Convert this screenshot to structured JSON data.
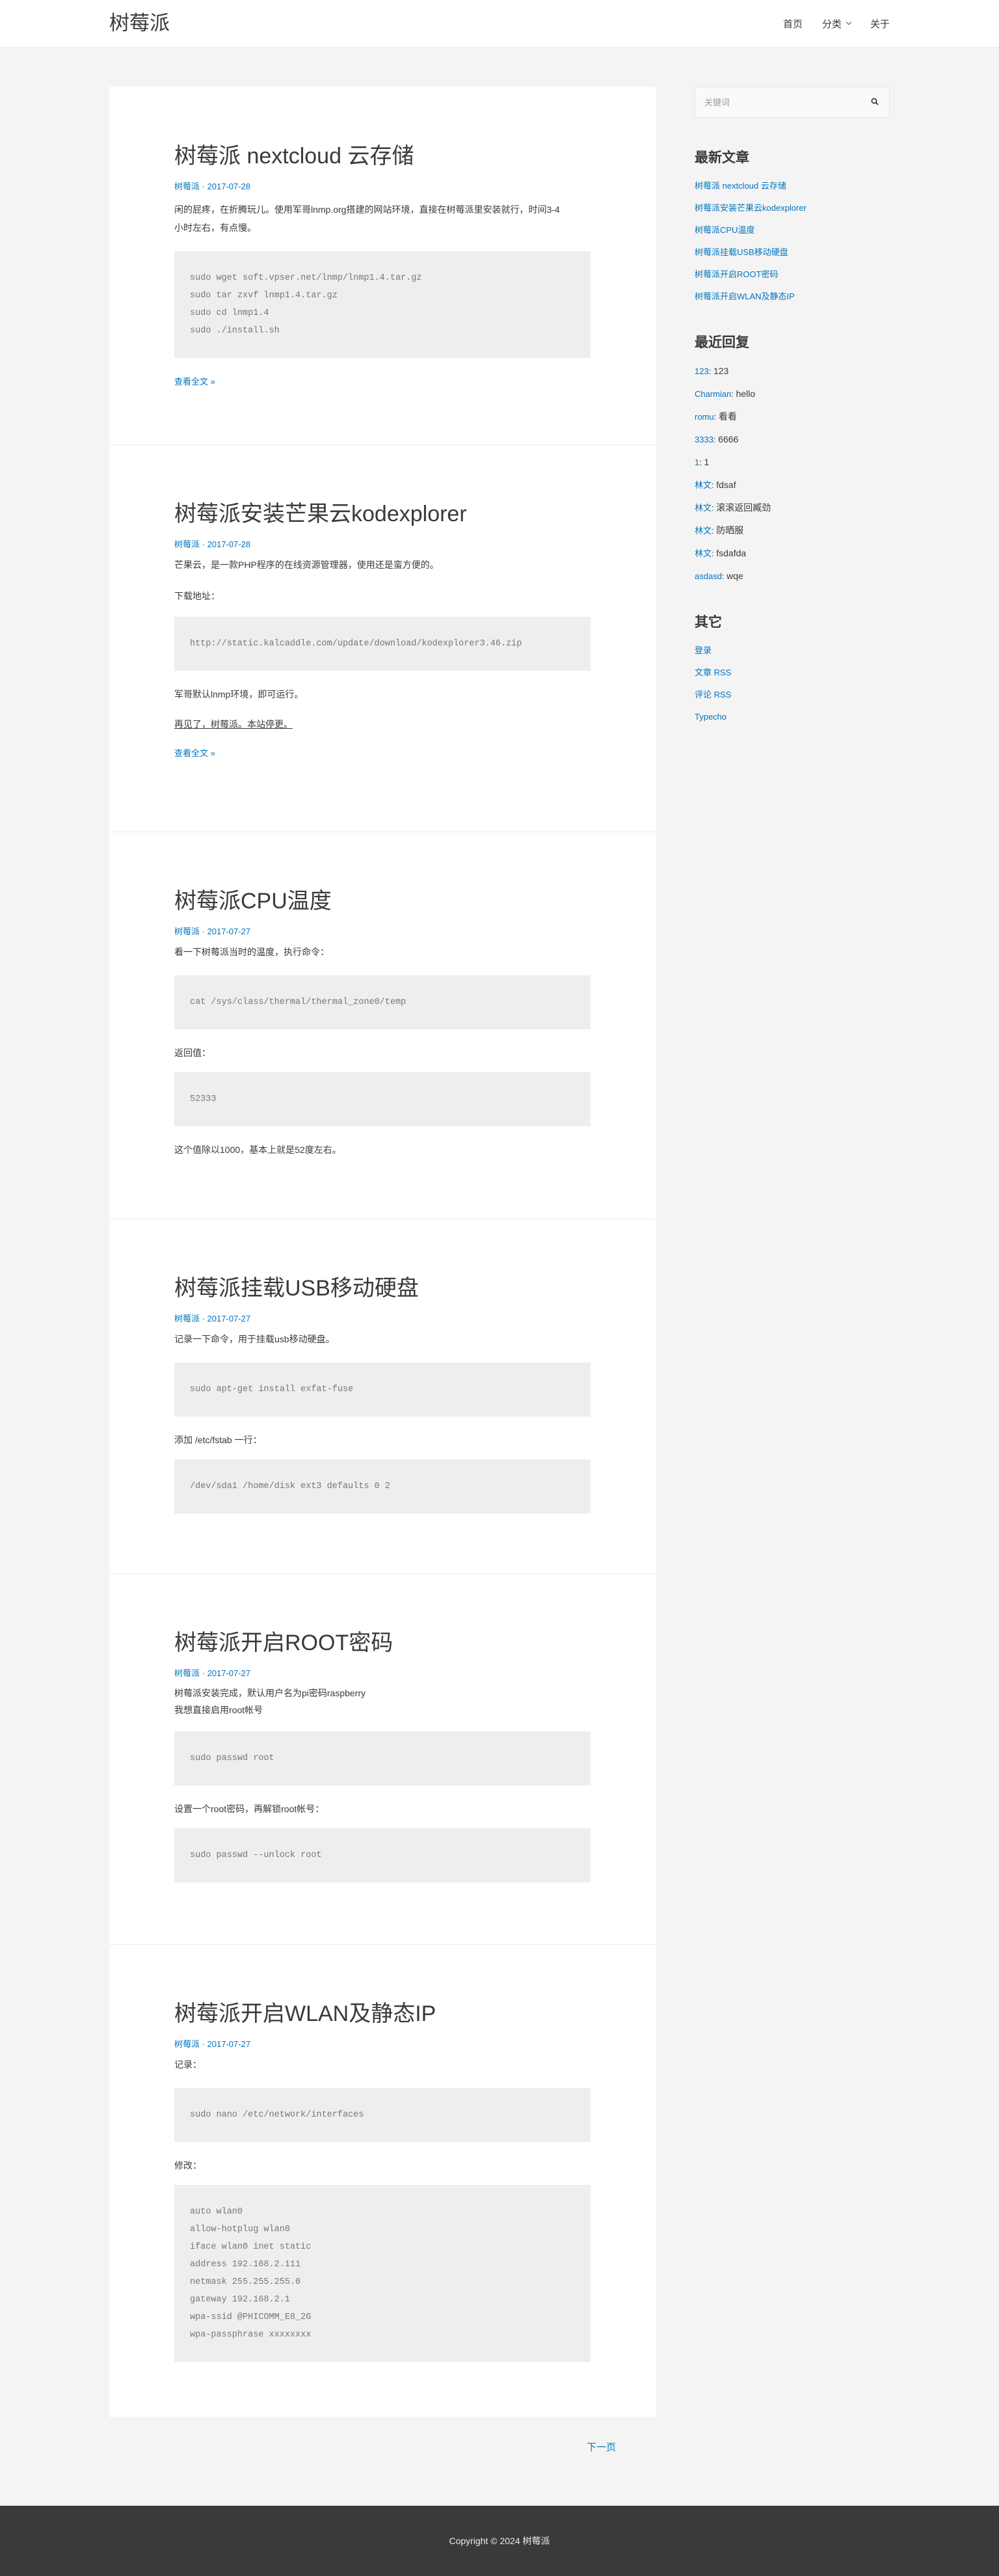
{
  "site": {
    "title": "树莓派"
  },
  "nav": {
    "home": "首页",
    "category": "分类",
    "about": "关于"
  },
  "posts": [
    {
      "title": "树莓派 nextcloud 云存储",
      "category": "树莓派",
      "date": "2017-07-28",
      "p1a": "闲的屁疼，在折腾玩儿。使用军哥lnmp.org搭建的网站环境，直接在树莓派里安装就行，时间3-4",
      "p1b": "小时左右，有点慢。",
      "code": [
        "sudo wget soft.vpser.net/lnmp/lnmp1.4.tar.gz",
        "sudo tar zxvf lnmp1.4.tar.gz",
        "sudo cd lnmp1.4",
        "sudo ./install.sh"
      ],
      "more": "查看全文 »"
    },
    {
      "title": "树莓派安装芒果云kodexplorer",
      "category": "树莓派",
      "date": "2017-07-28",
      "p1": "芒果云，是一款PHP程序的在线资源管理器，使用还是蛮方便的。",
      "p2": "下载地址：",
      "code": [
        "http://static.kalcaddle.com/update/download/kodexplorer3.46.zip"
      ],
      "p3": "军哥默认lnmp环境，即可运行。",
      "p4": "再见了，树莓派。本站停更。",
      "more": "查看全文 »"
    },
    {
      "title": "树莓派CPU温度",
      "category": "树莓派",
      "date": "2017-07-27",
      "p1": "看一下树莓派当时的温度，执行命令：",
      "code1": [
        "cat /sys/class/thermal/thermal_zone0/temp"
      ],
      "p2": "返回值：",
      "code2": [
        "52333"
      ],
      "p3": "这个值除以1000，基本上就是52度左右。"
    },
    {
      "title": "树莓派挂载USB移动硬盘",
      "category": "树莓派",
      "date": "2017-07-27",
      "p1": "记录一下命令，用于挂载usb移动硬盘。",
      "code1": [
        "sudo apt-get install exfat-fuse"
      ],
      "p2": "添加 /etc/fstab 一行：",
      "code2": [
        "/dev/sda1 /home/disk ext3 defaults 0 2"
      ]
    },
    {
      "title": "树莓派开启ROOT密码",
      "category": "树莓派",
      "date": "2017-07-27",
      "p1a": "树莓派安装完成，默认用户名为pi密码raspberry",
      "p1b": "我想直接启用root帐号",
      "code1": [
        "sudo passwd root"
      ],
      "p2": "设置一个root密码，再解锁root帐号：",
      "code2": [
        "sudo passwd --unlock root"
      ]
    },
    {
      "title": "树莓派开启WLAN及静态IP",
      "category": "树莓派",
      "date": "2017-07-27",
      "p1": "记录：",
      "code1": [
        "sudo nano /etc/network/interfaces"
      ],
      "p2": "修改：",
      "code2": [
        "auto wlan0",
        "allow-hotplug wlan0",
        "iface wlan0 inet static",
        "address 192.168.2.111",
        "netmask 255.255.255.0",
        "gateway 192.168.2.1",
        "wpa-ssid @PHICOMM_E8_2G",
        "wpa-passphrase xxxxxxxx"
      ]
    }
  ],
  "pagination": {
    "next": "下一页"
  },
  "sidebar": {
    "search_placeholder": "关键词",
    "recent_title": "最新文章",
    "recent": [
      "树莓派 nextcloud 云存储",
      "树莓派安装芒果云kodexplorer",
      "树莓派CPU温度",
      "树莓派挂载USB移动硬盘",
      "树莓派开启ROOT密码",
      "树莓派开启WLAN及静态IP"
    ],
    "comments_title": "最近回复",
    "comments": [
      {
        "author": "123",
        "text": "123"
      },
      {
        "author": "Charmian",
        "text": "hello"
      },
      {
        "author": "romu",
        "text": "看看"
      },
      {
        "author": "3333",
        "text": "6666"
      },
      {
        "author": "1",
        "text": "1"
      },
      {
        "author": "林文",
        "text": "fdsaf"
      },
      {
        "author": "林文",
        "text": "滚滚返回臧劲"
      },
      {
        "author": "林文",
        "text": "防晒服"
      },
      {
        "author": "林文",
        "text": "fsdafda"
      },
      {
        "author": "asdasd",
        "text": "wqe"
      }
    ],
    "other_title": "其它",
    "other": [
      "登录",
      "文章 RSS",
      "评论 RSS",
      "Typecho"
    ]
  },
  "footer": {
    "copyright": "Copyright © 2024 树莓派"
  }
}
